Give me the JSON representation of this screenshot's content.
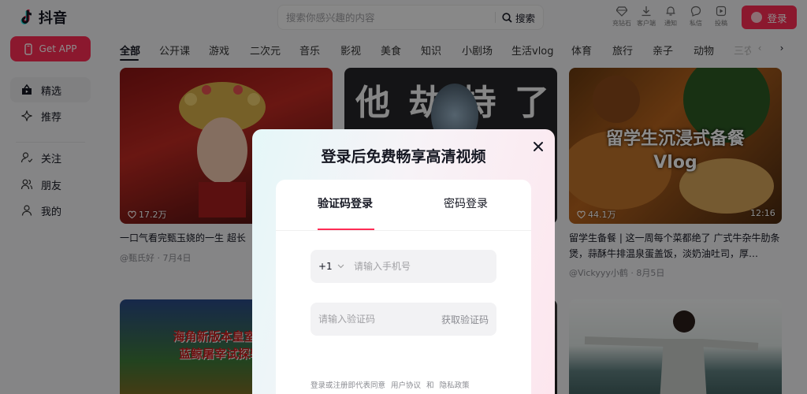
{
  "header": {
    "logo_text": "抖音",
    "search_placeholder": "搜索你感兴趣的内容",
    "search_button": "搜索",
    "top_icons": [
      "充钻石",
      "客户端",
      "通知",
      "私信",
      "投稿"
    ],
    "login_button": "登录"
  },
  "sidebar": {
    "get_app": "Get APP",
    "items": [
      {
        "label": "精选",
        "icon": "featured-icon",
        "active": true
      },
      {
        "label": "推荐",
        "icon": "sparkle-icon",
        "active": false
      },
      {
        "label": "关注",
        "icon": "follow-icon",
        "active": false
      },
      {
        "label": "朋友",
        "icon": "friends-icon",
        "active": false
      },
      {
        "label": "我的",
        "icon": "profile-icon",
        "active": false
      }
    ]
  },
  "tabs": [
    "全部",
    "公开课",
    "游戏",
    "二次元",
    "音乐",
    "影视",
    "美食",
    "知识",
    "小剧场",
    "生活vlog",
    "体育",
    "旅行",
    "亲子",
    "动物",
    "三农"
  ],
  "cards": [
    {
      "likes": "17.2万",
      "duration": "",
      "title": "一口气看完甄玉娆的一生 超长",
      "author": "@甄氏好",
      "date": "7月4日",
      "image_text": ""
    },
    {
      "likes": "",
      "duration": "",
      "title": "",
      "author": "",
      "date": "",
      "image_text": "他 劫 持 了"
    },
    {
      "likes": "44.1万",
      "duration": "12:16",
      "title": "留学生备餐 | 这一周每个菜都绝了 广式牛杂牛肋条煲，蒜酥牛排温泉蛋盖饭，淡奶油吐司，厚…",
      "author": "@Vickyyy小鹤",
      "date": "8月5日",
      "image_text": "留学生沉浸式备餐\nVlog"
    },
    {
      "image_text": "海角新版本皇室喷面\n蓝鲸屠宰试探轻新"
    }
  ],
  "modal": {
    "title": "登录后免费畅享高清视频",
    "tabs": [
      "验证码登录",
      "密码登录"
    ],
    "country_code": "+1",
    "phone_placeholder": "请输入手机号",
    "code_placeholder": "请输入验证码",
    "get_code": "获取验证码",
    "agreement_prefix": "登录或注册即代表同意",
    "user_agreement": "用户协议",
    "and": "和",
    "privacy_policy": "隐私政策"
  },
  "colors": {
    "brand": "#fe2c55",
    "text": "#161823",
    "muted": "#8a8b91"
  }
}
